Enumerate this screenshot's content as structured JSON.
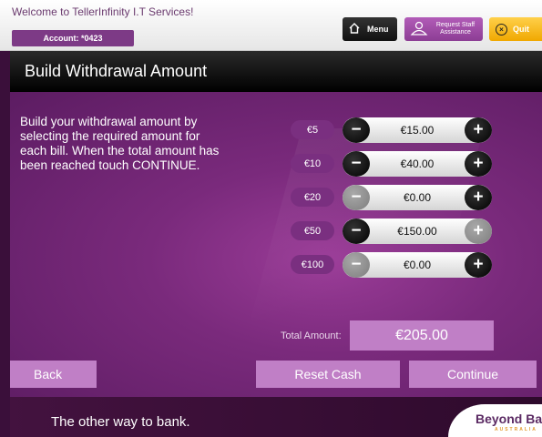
{
  "header": {
    "welcome": "Welcome to TellerInfinity I.T Services!",
    "account": "Account: *0423",
    "menu_label": "Menu",
    "staff_line1": "Request Staff",
    "staff_line2": "Assistance",
    "quit_label": "Quit"
  },
  "page": {
    "title": "Build Withdrawal Amount",
    "instructions": "Build your withdrawal amount by selecting the required amount for each bill. When the total amount has been reached touch CONTINUE."
  },
  "bills": [
    {
      "denomination": "€5",
      "amount": "€15.00",
      "minus_enabled": true,
      "plus_enabled": true
    },
    {
      "denomination": "€10",
      "amount": "€40.00",
      "minus_enabled": true,
      "plus_enabled": true
    },
    {
      "denomination": "€20",
      "amount": "€0.00",
      "minus_enabled": false,
      "plus_enabled": true
    },
    {
      "denomination": "€50",
      "amount": "€150.00",
      "minus_enabled": true,
      "plus_enabled": false
    },
    {
      "denomination": "€100",
      "amount": "€0.00",
      "minus_enabled": false,
      "plus_enabled": true
    }
  ],
  "total": {
    "label": "Total Amount:",
    "value": "€205.00"
  },
  "actions": {
    "back": "Back",
    "reset": "Reset Cash",
    "continue": "Continue"
  },
  "footer": {
    "tagline": "The other way to bank.",
    "brand_name": "Beyond Bank",
    "brand_sub": "AUSTRALIA"
  }
}
